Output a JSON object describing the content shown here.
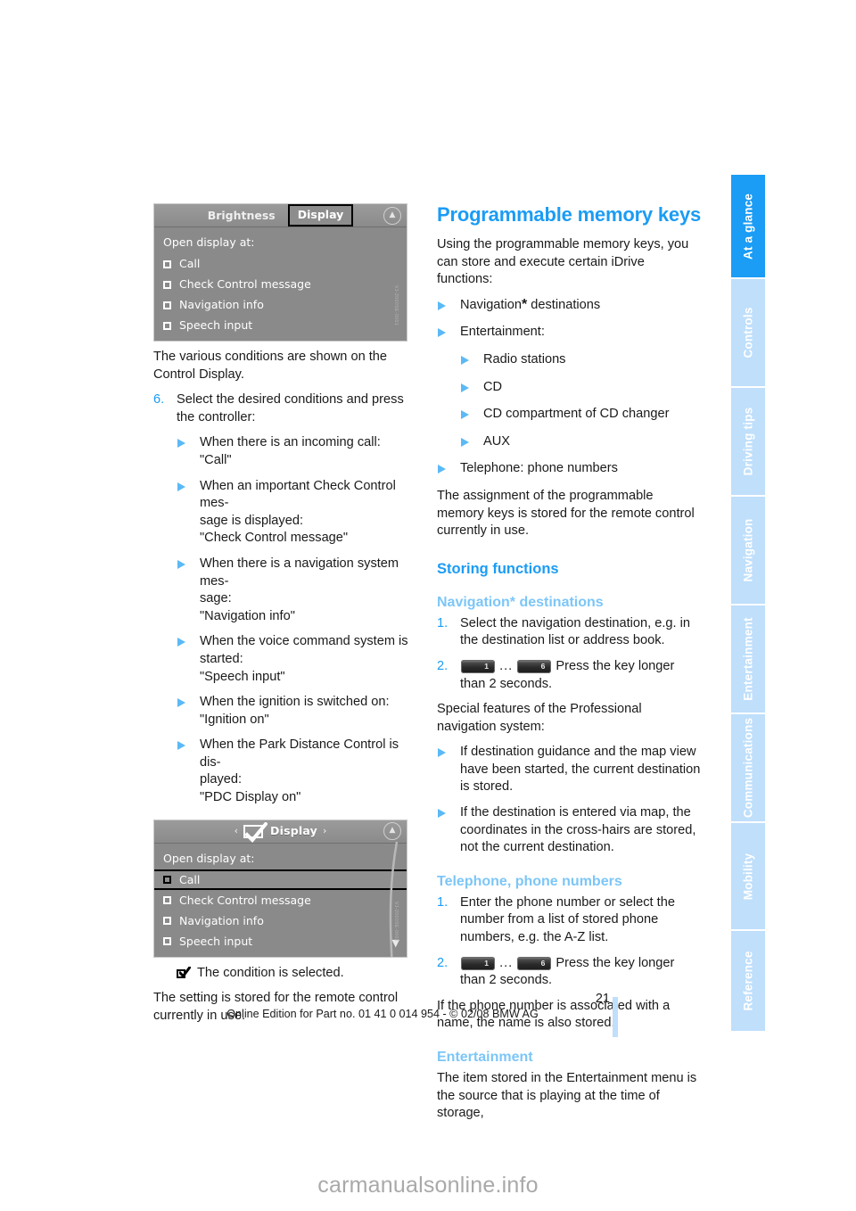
{
  "tabs": [
    {
      "label": "At a glance",
      "active": true
    },
    {
      "label": "Controls",
      "active": false
    },
    {
      "label": "Driving tips",
      "active": false
    },
    {
      "label": "Navigation",
      "active": false
    },
    {
      "label": "Entertainment",
      "active": false
    },
    {
      "label": "Communications",
      "active": false
    },
    {
      "label": "Mobility",
      "active": false
    },
    {
      "label": "Reference",
      "active": false
    }
  ],
  "shot1": {
    "bar_inactive": "Brightness",
    "bar_boxed": "Display",
    "updown_icon": "up-down-arrows-icon",
    "header": "Open display at:",
    "items": [
      {
        "label": "Call",
        "selected": false
      },
      {
        "label": "Check Control message",
        "selected": false
      },
      {
        "label": "Navigation info",
        "selected": false
      },
      {
        "label": "Speech input",
        "selected": false
      }
    ],
    "code": "VJ-2000SE-0001"
  },
  "shot2": {
    "arrow_left": "‹",
    "arrow_right": "›",
    "check_icon": "checked-box-icon",
    "bar_title": "Display",
    "updown_icon": "up-down-arrows-icon",
    "header": "Open display at:",
    "items": [
      {
        "label": "Call",
        "selected": true
      },
      {
        "label": "Check Control message",
        "selected": false
      },
      {
        "label": "Navigation info",
        "selected": false
      },
      {
        "label": "Speech input",
        "selected": false
      }
    ],
    "code": "VJ-2000SE-0002"
  },
  "left": {
    "intro": "The various conditions are shown on the Control Display.",
    "step6_num": "6.",
    "step6_text": "Select the desired conditions and press the controller:",
    "conditions": [
      "When there is an incoming call:\n\"Call\"",
      "When an important Check Control mes-sage is displayed:\n\"Check Control message\"",
      "When there is a navigation system mes-sage:\n\"Navigation info\"",
      "When the voice command system is started:\n\"Speech input\"",
      "When the ignition is switched on:\n\"Ignition on\"",
      "When the Park Distance Control is dis-played:\n\"PDC Display on\""
    ],
    "conditions_lines": [
      [
        "When there is an incoming call:",
        "\"Call\""
      ],
      [
        "When an important Check Control mes-",
        "sage is displayed:",
        "\"Check Control message\""
      ],
      [
        "When there is a navigation system mes-",
        "sage:",
        "\"Navigation info\""
      ],
      [
        "When the voice command system is",
        "started:",
        "\"Speech input\""
      ],
      [
        "When the ignition is switched on:",
        "\"Ignition on\""
      ],
      [
        "When the Park Distance Control is dis-",
        "played:",
        "\"PDC Display on\""
      ]
    ],
    "tick_text": "The condition is selected.",
    "tick_icon": "checked-box-icon",
    "closing": "The setting is stored for the remote control currently in use."
  },
  "right": {
    "title": "Programmable memory keys",
    "intro": "Using the programmable memory keys, you can store and execute certain iDrive functions:",
    "bullets_l0_a": "Navigation",
    "bullets_l0_a_star": "*",
    "bullets_l0_a_rest": " destinations",
    "bullets_l0_b": "Entertainment:",
    "bullets_l1": [
      "Radio stations",
      "CD",
      "CD compartment of CD changer",
      "AUX"
    ],
    "bullets_l0_c": "Telephone: phone numbers",
    "para_assignment": "The assignment of the programmable memory keys is stored for the remote control currently in use.",
    "h_storing": "Storing functions",
    "h_nav": "Navigation* destinations",
    "nav_step1_num": "1.",
    "nav_step1": "Select the navigation destination, e.g. in the destination list or address book.",
    "nav_step2_num": "2.",
    "key_low": "1",
    "key_high": "6",
    "key_ellipsis": "...",
    "nav_step2": "Press the key longer than 2 seconds.",
    "special_intro": "Special features of the Professional navigation system:",
    "special_bullets": [
      "If destination guidance and the map view have been started, the current destination is stored.",
      "If the destination is entered via map, the coordinates in the cross-hairs are stored, not the current destination."
    ],
    "h_phone": "Telephone, phone numbers",
    "ph_step1_num": "1.",
    "ph_step1": "Enter the phone number or select the number from a list of stored phone numbers, e.g. the A-Z list.",
    "ph_step2_num": "2.",
    "ph_step2": "Press the key longer than 2 seconds.",
    "para_name": "If the phone number is associated with a name, the name is also stored.",
    "h_entertainment": "Entertainment",
    "para_entertainment": "The item stored in the Entertainment menu is the source that is playing at the time of storage,"
  },
  "footer": {
    "page_number": "21",
    "line": "Online Edition for Part no. 01 41 0 014 954  - © 02/08 BMW AG"
  },
  "watermark": "carmanualsonline.info",
  "colors": {
    "accent_blue": "#1b9cf5",
    "light_blue": "#7cc6f7",
    "tab_inactive": "#bfdffb",
    "screen_gray": "#8a8a8a"
  }
}
